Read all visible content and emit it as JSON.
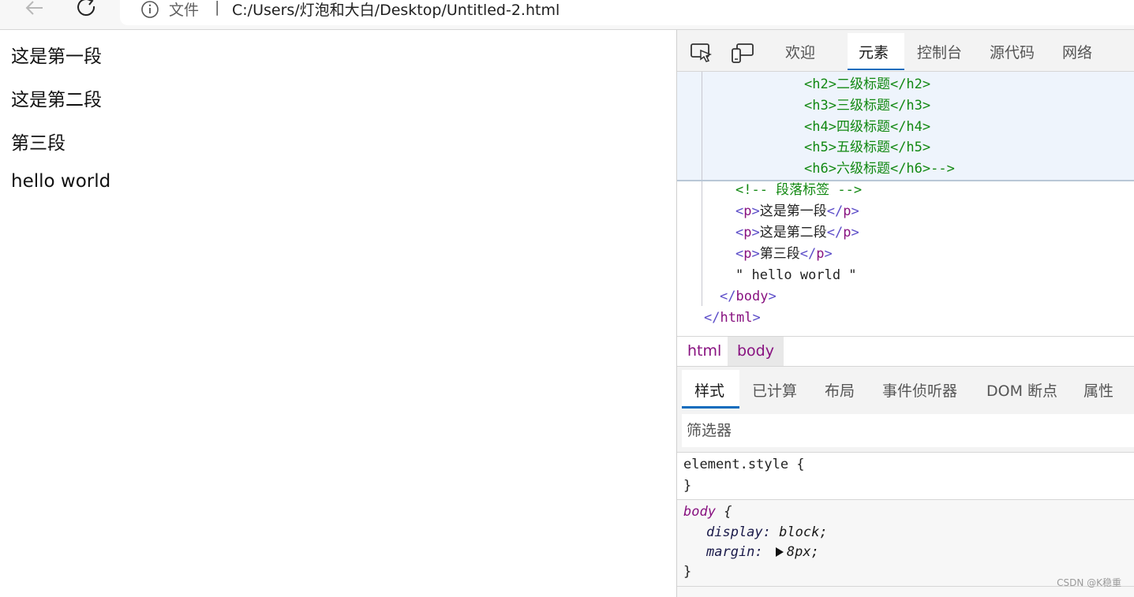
{
  "browser": {
    "file_label": "文件",
    "separator": "|",
    "url": "C:/Users/灯泡和大白/Desktop/Untitled-2.html"
  },
  "page": {
    "paragraphs": [
      "这是第一段",
      "这是第二段",
      "第三段",
      "hello world"
    ]
  },
  "devtools": {
    "tabs": [
      "欢迎",
      "元素",
      "控制台",
      "源代码",
      "网络"
    ],
    "active_tab": "元素",
    "dom": {
      "comment_lines": [
        {
          "open": "<h2>",
          "text": "二级标题",
          "close": "</h2>"
        },
        {
          "open": "<h3>",
          "text": "三级标题",
          "close": "</h3>"
        },
        {
          "open": "<h4>",
          "text": "四级标题",
          "close": "</h4>"
        },
        {
          "open": "<h5>",
          "text": "五级标题",
          "close": "</h5>"
        },
        {
          "open": "<h6>",
          "text": "六级标题",
          "close": "</h6>-->"
        }
      ],
      "comment": "<!-- 段落标签 -->",
      "p_lines": [
        "这是第一段",
        "这是第二段",
        "第三段"
      ],
      "p_open": "<",
      "p_tag": "p",
      "p_gt": ">",
      "p_close_lt": "</",
      "p_close_gt": ">",
      "text_node": "\" hello world \"",
      "body_close_lt": "</",
      "body_close_tag": "body",
      "html_close_tag": "html",
      "close_gt": ">"
    },
    "breadcrumb": [
      "html",
      "body"
    ],
    "styles_tabs": [
      "样式",
      "已计算",
      "布局",
      "事件侦听器",
      "DOM 断点",
      "属性"
    ],
    "active_styles_tab": "样式",
    "filter_placeholder": "筛选器",
    "rules": {
      "element_style_selector": "element.style {",
      "close_brace": "}",
      "body_selector": "body",
      "open_brace": " {",
      "decl1_prop": "display",
      "decl1_val": "block",
      "decl2_prop": "margin",
      "decl2_val": "8px",
      "colon": ": ",
      "semicolon": ";"
    }
  },
  "watermark": "CSDN @K稳重",
  "colors": {
    "accent": "#0f6cbd",
    "tag": "#881280",
    "comment": "#118811"
  }
}
